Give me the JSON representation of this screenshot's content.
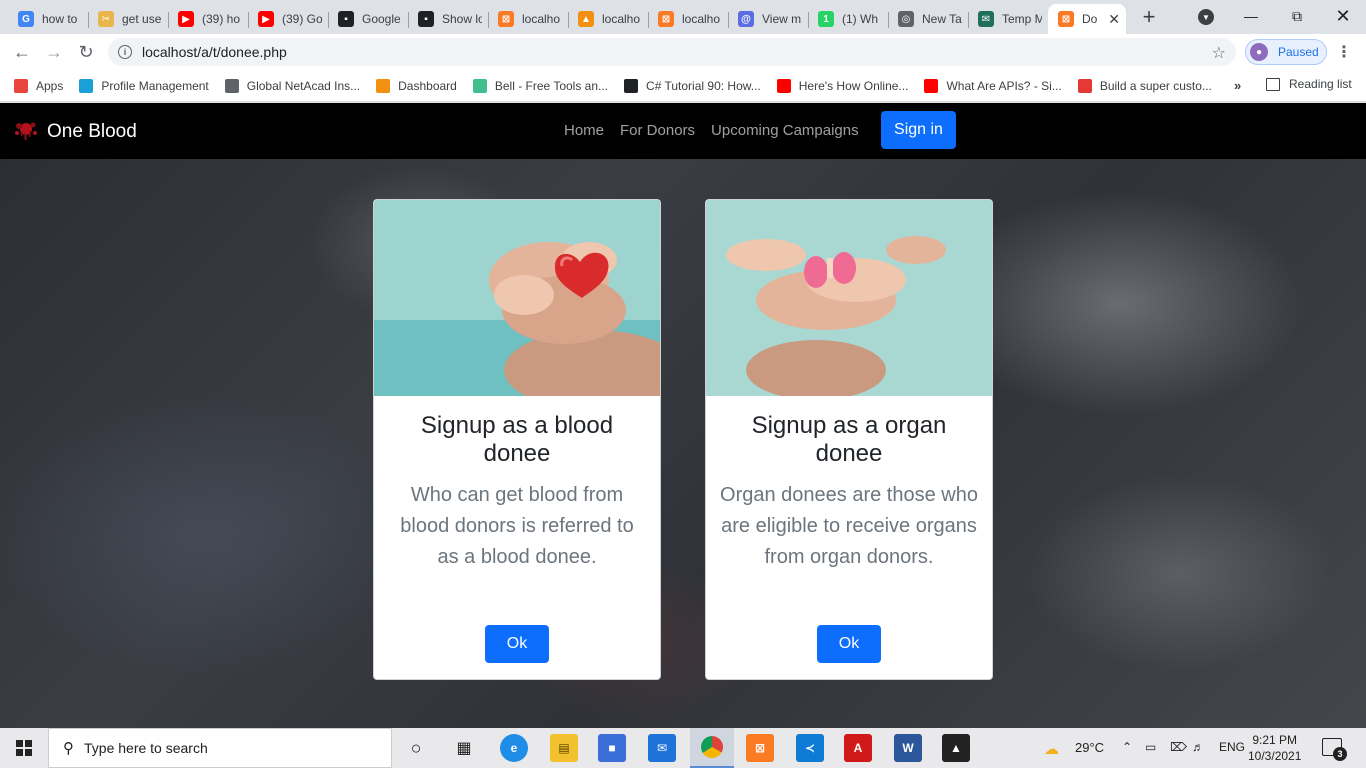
{
  "browser": {
    "tabs": [
      {
        "label": "how to",
        "icon": "google-icon",
        "color": "#4285f4",
        "glyph": "G"
      },
      {
        "label": "get use",
        "icon": "sprout-icon",
        "color": "#e8b64a",
        "glyph": "✂"
      },
      {
        "label": "(39) ho",
        "icon": "youtube-icon",
        "color": "#ff0000",
        "glyph": "▶"
      },
      {
        "label": "(39) Go",
        "icon": "youtube-icon",
        "color": "#ff0000",
        "glyph": "▶"
      },
      {
        "label": "Google",
        "icon": "terminal-icon",
        "color": "#202124",
        "glyph": "▪"
      },
      {
        "label": "Show lo",
        "icon": "terminal-icon",
        "color": "#202124",
        "glyph": "▪"
      },
      {
        "label": "localho",
        "icon": "xampp-icon",
        "color": "#fb7a24",
        "glyph": "⊠"
      },
      {
        "label": "localho",
        "icon": "phpmyadmin-icon",
        "color": "#f29111",
        "glyph": "▲"
      },
      {
        "label": "localho",
        "icon": "xampp-icon",
        "color": "#fb7a24",
        "glyph": "⊠"
      },
      {
        "label": "View m",
        "icon": "at-icon",
        "color": "#5b6ee1",
        "glyph": "@"
      },
      {
        "label": "(1) Wh",
        "icon": "whatsapp-icon",
        "color": "#25d366",
        "glyph": "1"
      },
      {
        "label": "New Ta",
        "icon": "chrome-icon",
        "color": "#5f6368",
        "glyph": "◎"
      },
      {
        "label": "Temp M",
        "icon": "temp-mail-icon",
        "color": "#1f6f5c",
        "glyph": "✉"
      },
      {
        "label": "Do",
        "icon": "xampp-icon",
        "color": "#fb7a24",
        "glyph": "⊠",
        "active": true
      }
    ],
    "new_tab": "+",
    "url": "localhost/a/t/donee.php",
    "profile_label": "Paused",
    "bookmarks": [
      {
        "label": "Apps",
        "icon": "apps-grid-icon",
        "color": "#e8453c"
      },
      {
        "label": "Profile Management",
        "icon": "cisco-icon",
        "color": "#1ba0d7"
      },
      {
        "label": "Global NetAcad Ins...",
        "icon": "netacad-icon",
        "color": "#5f6368"
      },
      {
        "label": "Dashboard",
        "icon": "dashboard-icon",
        "color": "#f29111"
      },
      {
        "label": "Bell - Free Tools an...",
        "icon": "bell-v-icon",
        "color": "#3fbf8f"
      },
      {
        "label": "C# Tutorial 90: How...",
        "icon": "globe-icon",
        "color": "#202124"
      },
      {
        "label": "Here's How Online...",
        "icon": "youtube-icon",
        "color": "#ff0000"
      },
      {
        "label": "What Are APIs? - Si...",
        "icon": "youtube-icon",
        "color": "#ff0000"
      },
      {
        "label": "Build a super custo...",
        "icon": "sl-icon",
        "color": "#e53935"
      }
    ],
    "more": "»",
    "reading_list": "Reading list"
  },
  "site": {
    "brand": "One Blood",
    "nav": [
      "Home",
      "For Donors",
      "Upcoming Campaigns"
    ],
    "signin": "Sign in",
    "cards": [
      {
        "title": "Signup as a blood donee",
        "description": "Who can get blood from blood donors is referred to as a blood donee.",
        "button": "Ok"
      },
      {
        "title": "Signup as a organ donee",
        "description": "Organ donees are those who are eligible to receive organs from organ donors.",
        "button": "Ok"
      }
    ]
  },
  "taskbar": {
    "search_placeholder": "Type here to search",
    "weather": "29°C",
    "language": "ENG",
    "time": "9:21 PM",
    "date": "10/3/2021",
    "notifications": "3"
  },
  "colors": {
    "primary": "#0d6efd",
    "navbar": "#000000",
    "brand_logo": "#b3121c"
  }
}
